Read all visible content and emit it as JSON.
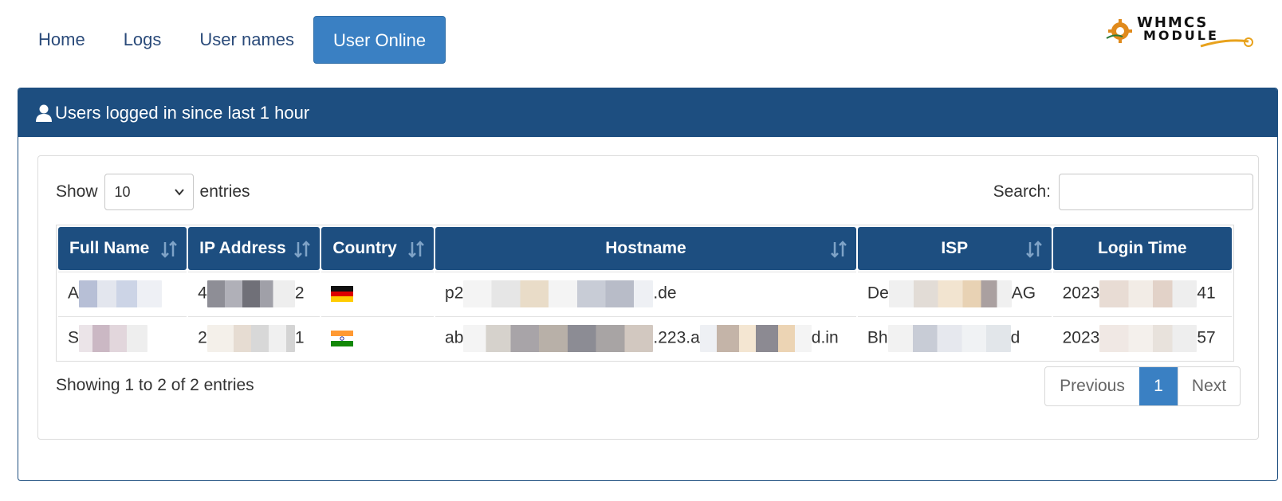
{
  "nav": {
    "items": [
      {
        "label": "Home",
        "active": false
      },
      {
        "label": "Logs",
        "active": false
      },
      {
        "label": "User names",
        "active": false
      },
      {
        "label": "User Online",
        "active": true
      }
    ]
  },
  "logo": {
    "line1": "WHMCS",
    "line2": "MODULE"
  },
  "panel": {
    "title": "Users logged in since last 1 hour"
  },
  "controls": {
    "show_label": "Show",
    "entries_value": "10",
    "entries_label": "entries",
    "search_label": "Search:"
  },
  "table": {
    "columns": [
      "Full Name",
      "IP Address",
      "Country",
      "Hostname",
      "ISP",
      "Login Time"
    ],
    "rows": [
      {
        "name_prefix": "A",
        "name_suffix": "",
        "ip_prefix": "4",
        "ip_suffix": "2",
        "country_icon": "germany-flag-icon",
        "host_prefix": "p2",
        "host_mid": "",
        "host_suffix": ".de",
        "isp_prefix": "De",
        "isp_suffix": "AG",
        "time_prefix": "2023",
        "time_suffix": "41"
      },
      {
        "name_prefix": "S",
        "name_suffix": "",
        "ip_prefix": "2",
        "ip_suffix": "1",
        "country_icon": "india-flag-icon",
        "host_prefix": "ab",
        "host_mid": ".223.a",
        "host_suffix": "d.in",
        "isp_prefix": "Bh",
        "isp_suffix": "d",
        "time_prefix": "2023",
        "time_suffix": "57"
      }
    ]
  },
  "footer": {
    "info": "Showing 1 to 2 of 2 entries",
    "prev_label": "Previous",
    "page": "1",
    "next_label": "Next"
  },
  "colors": {
    "header_blue": "#1d4e80",
    "active_tab": "#3a80c3",
    "nav_text": "#2b4b7a"
  }
}
